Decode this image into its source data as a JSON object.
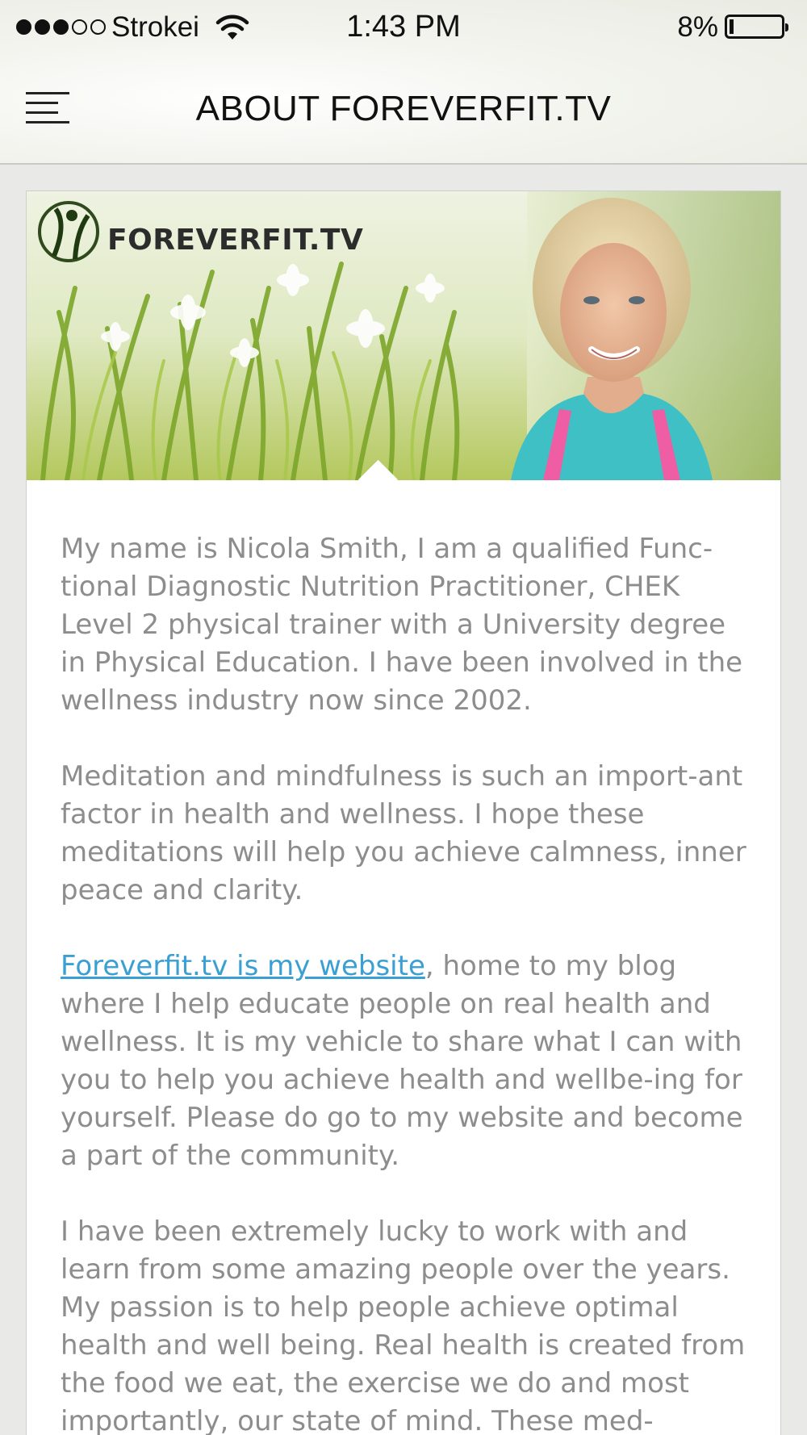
{
  "status_bar": {
    "signal_dots_filled": 3,
    "signal_dots_total": 5,
    "carrier": "Strokei",
    "time": "1:43 PM",
    "battery_percent_label": "8%",
    "battery_level": 0.08,
    "wifi_icon": "wifi-icon"
  },
  "nav": {
    "menu_icon": "hamburger-menu-icon",
    "title": "ABOUT FOREVERFIT.TV"
  },
  "banner": {
    "logo_text": "FOREVERFIT.TV"
  },
  "content": {
    "paragraph_1": "My name is Nicola Smith, I am a qualified Func-tional Diagnostic Nutrition Practitioner,  CHEK Level 2 physical trainer with a University degree in Physical Education. I have been involved in the wellness industry now since 2002.",
    "paragraph_2": "Meditation and mindfulness is such an import-ant factor in health and wellness. I hope these meditations will help you achieve calmness, inner peace and clarity.",
    "paragraph_3_link": "Foreverfit.tv is my website",
    "paragraph_3_rest": ", home to my blog where I help educate people on real health and wellness. It is my vehicle to share what I can with you to help you achieve health and wellbe-ing for yourself. Please do go to my website and become a part of the community.",
    "paragraph_4": "I have been extremely lucky to work with and learn from some amazing people over the years. My passion is to help people achieve optimal health and well being. Real health is created from the food we eat, the exercise we do and most importantly, our state of mind. These med-"
  },
  "colors": {
    "link": "#3a9fd3",
    "body_text": "#8d8d8d",
    "title_text": "#111111"
  }
}
